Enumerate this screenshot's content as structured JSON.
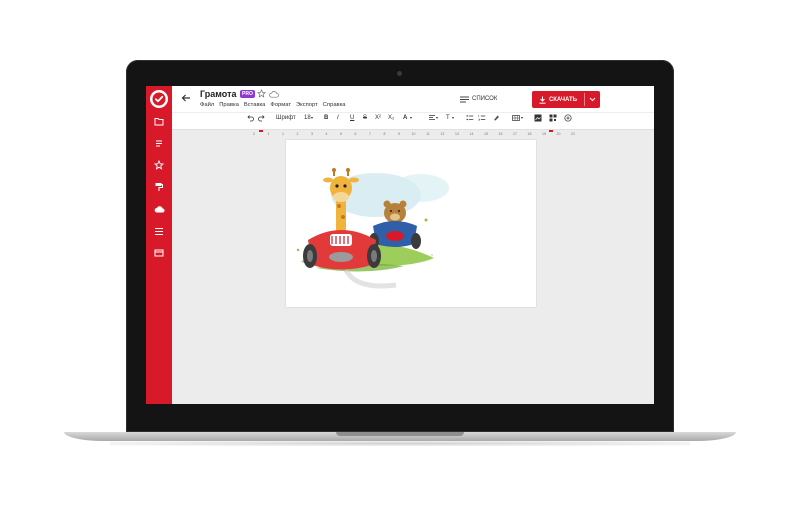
{
  "app": {
    "title": "Грамота",
    "pro_badge": "PRO",
    "menu": [
      "Файл",
      "Правка",
      "Вставка",
      "Формат",
      "Экспорт",
      "Справка"
    ],
    "list_label": "СПИСОК",
    "download_label": "СКАЧАТЬ"
  },
  "toolbar": {
    "font": "Шрифт",
    "font_size": "18",
    "bold": "B",
    "italic": "I",
    "underline": "U",
    "strike": "S",
    "superscript": "X²",
    "subscript": "X₂",
    "text_color": "A",
    "text_style": "T"
  },
  "ruler": {
    "ticks": [
      "2",
      "1",
      "1",
      "2",
      "3",
      "4",
      "5",
      "6",
      "7",
      "8",
      "9",
      "10",
      "11",
      "12",
      "13",
      "14",
      "15",
      "16",
      "17",
      "18",
      "19",
      "20",
      "21"
    ]
  },
  "colors": {
    "brand_red": "#d7192a",
    "pro_purple": "#8e3ad1",
    "canvas_bg": "#ececec"
  },
  "sidebar": {
    "icons": [
      "folder-icon",
      "document-icon",
      "star-icon",
      "paint-roller-icon",
      "cloud-icon",
      "list-icon",
      "card-icon"
    ]
  },
  "document": {
    "image": "illustration-giraffe-and-bear-in-race-cars"
  }
}
